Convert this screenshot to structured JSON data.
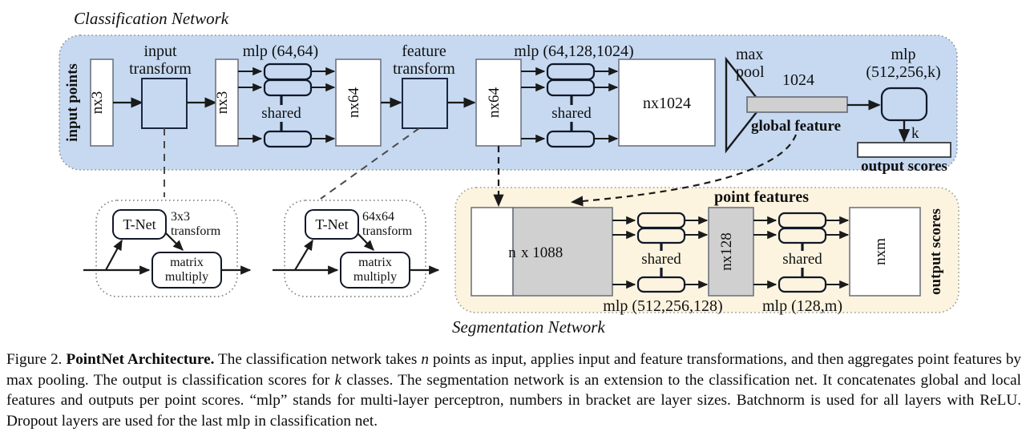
{
  "figure": {
    "classification_panel": {
      "title": "Classification Network",
      "side_label": "input points",
      "blocks": {
        "nx3_in": "nx3",
        "input_transform_label": "input\ntransform",
        "input_transform_line1": "input",
        "input_transform_line2": "transform",
        "nx3_out": "nx3",
        "mlp1": "mlp (64,64)",
        "shared1": "shared",
        "nx64_a": "nx64",
        "feature_transform_line1": "feature",
        "feature_transform_line2": "transform",
        "nx64_b": "nx64",
        "mlp2": "mlp (64,128,1024)",
        "shared2": "shared",
        "nx1024": "nx1024",
        "maxpool_line1": "max",
        "maxpool_line2": "pool",
        "feature_dim": "1024",
        "global_feature": "global feature",
        "mlp3_line1": "mlp",
        "mlp3_line2": "(512,256,k)",
        "k_label": "k",
        "output_scores": "output scores"
      }
    },
    "tnet_input": {
      "tnet": "T-Net",
      "transform_line1": "3x3",
      "transform_line2": "transform",
      "matmul_line1": "matrix",
      "matmul_line2": "multiply"
    },
    "tnet_feature": {
      "tnet": "T-Net",
      "transform_line1": "64x64",
      "transform_line2": "transform",
      "matmul_line1": "matrix",
      "matmul_line2": "multiply"
    },
    "segmentation_panel": {
      "title": "Segmentation Network",
      "side_label": "output scores",
      "point_features": "point features",
      "blocks": {
        "concat_n": "n",
        "concat_dim": "x 1088",
        "mlp4": "mlp (512,256,128)",
        "shared3": "shared",
        "nx128": "nx128",
        "mlp5": "mlp (128,m)",
        "shared4": "shared",
        "nxm": "nxm"
      }
    }
  },
  "caption": {
    "prefix": "Figure 2.",
    "bold_title": "PointNet Architecture.",
    "seg1": " The classification network takes ",
    "var_n": "n",
    "seg2": " points as input, applies input and feature transformations, and then aggregates point features by max pooling. The output is classification scores for ",
    "var_k": "k",
    "seg3": " classes. The segmentation network is an extension to the classification net. It concatenates global and local features and outputs per point scores. “mlp” stands for multi-layer perceptron, numbers in bracket are layer sizes. Batchnorm is used for all layers with ReLU. Dropout layers are used for the last mlp in classification net."
  },
  "colors": {
    "classification_fill": "#c6d9f1",
    "segmentation_fill": "#fdf4e0",
    "gray_block": "#d0d0d0",
    "white_block": "#ffffff",
    "stroke": "#1a1a1a",
    "panel_border": "#7f7f7f"
  }
}
